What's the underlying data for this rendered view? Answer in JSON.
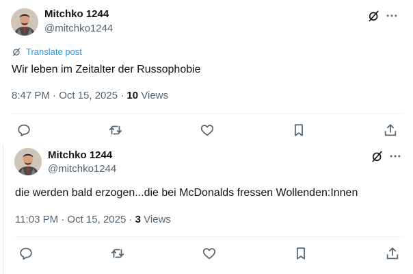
{
  "posts": [
    {
      "author_name": "Mitchko 1244",
      "author_handle": "@mitchko1244",
      "translate_label": "Translate post",
      "text": "Wir leben im Zeitalter der Russophobie",
      "time": "8:47 PM · Oct 15, 2025 · ",
      "views_count": "10",
      "views_label": " Views"
    },
    {
      "author_name": "Mitchko 1244",
      "author_handle": "@mitchko1244",
      "text": "die werden bald erzogen...die bei McDonalds fressen Wollenden:Innen",
      "time": "11:03 PM · Oct 15, 2025 · ",
      "views_count": "3",
      "views_label": " Views"
    }
  ],
  "icons": [
    "avatar-photo",
    "grok-icon",
    "more-icon",
    "reply-icon",
    "repost-icon",
    "like-icon",
    "bookmark-icon",
    "share-icon"
  ],
  "colors": {
    "text": "#0f1419",
    "secondary": "#536471",
    "link": "#1d9bf0",
    "divider": "#eff3f4"
  }
}
